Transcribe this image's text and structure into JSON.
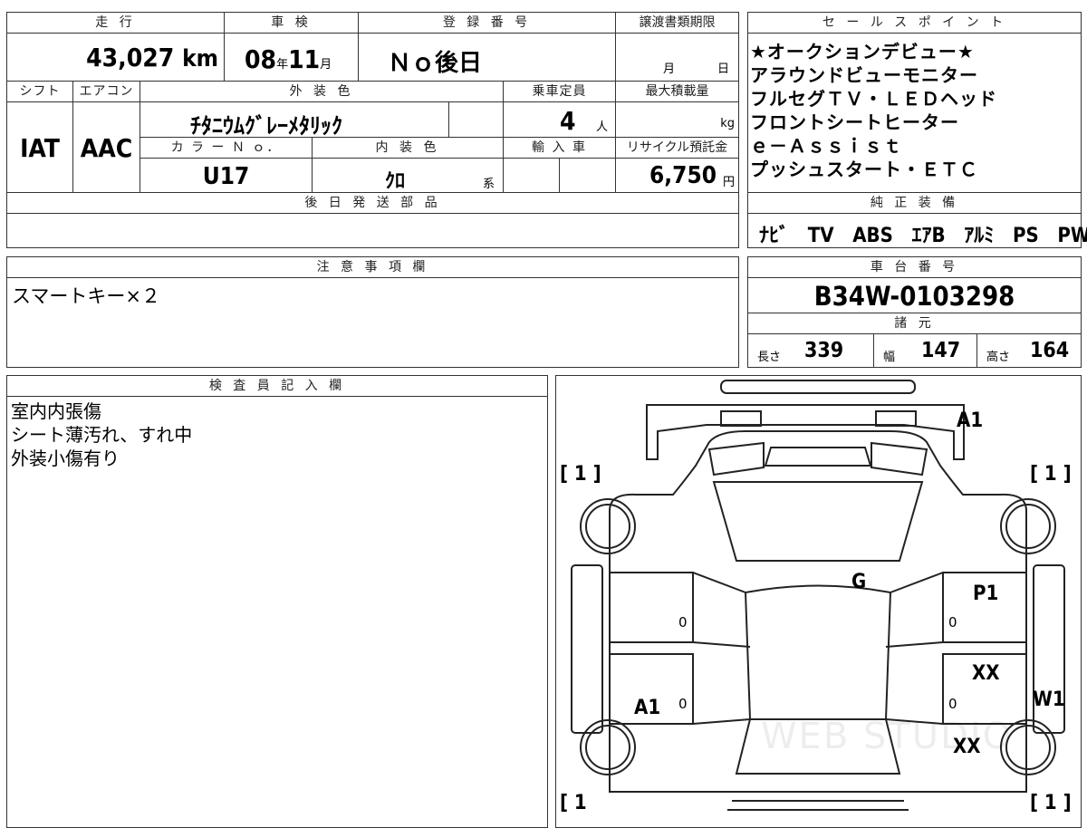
{
  "spec": {
    "mileage_label": "走 行",
    "mileage_value": "43,027",
    "mileage_unit": "km",
    "inspection_label": "車 検",
    "inspection_year": "08",
    "inspection_year_unit": "年",
    "inspection_month": "11",
    "inspection_month_unit": "月",
    "registration_label": "登 録 番 号",
    "registration_value": "Ｎｏ後日",
    "transfer_label": "譲渡書類期限",
    "transfer_month": "月",
    "transfer_day": "日",
    "shift_label": "シフト",
    "shift_value": "IAT",
    "aircon_label": "エアコン",
    "aircon_value": "AAC",
    "exterior_label": "外 装 色",
    "exterior_value": "ﾁﾀﾆｳﾑｸﾞﾚｰﾒﾀﾘｯｸ",
    "capacity_label": "乗車定員",
    "capacity_value": "4",
    "capacity_unit": "人",
    "maxload_label": "最大積載量",
    "maxload_unit": "kg",
    "colorno_label": "カ ラ ー Ｎ ｏ．",
    "colorno_value": "U17",
    "interior_label": "内 装 色",
    "interior_value": "ｸﾛ",
    "interior_suffix": "系",
    "import_label": "輸 入 車",
    "recycle_label": "リサイクル預託金",
    "recycle_value": "6,750",
    "recycle_unit": "円",
    "later_parts_label": "後 日 発 送 部 品"
  },
  "sales_points": {
    "title": "セ ー ル ス ポ イ ン ト",
    "lines": [
      "★オークションデビュー★",
      "アラウンドビューモニター",
      "フルセグＴＶ・ＬＥＤヘッド",
      "フロントシートヒーター",
      "ｅ－Ａｓｓｉｓｔ",
      "プッシュスタート・ＥＴＣ"
    ]
  },
  "equipment": {
    "title": "純 正 装 備",
    "items": [
      "ﾅﾋﾞ",
      "TV",
      "ABS",
      "ｴｱB",
      "ｱﾙﾐ",
      "PS",
      "PW"
    ]
  },
  "notes": {
    "title": "注 意 事 項 欄",
    "text": "スマートキー×２"
  },
  "chassis": {
    "title": "車 台 番 号",
    "value": "B34W-0103298"
  },
  "dimensions": {
    "title": "諸 元",
    "length_label": "長さ",
    "length_value": "339",
    "width_label": "幅",
    "width_value": "147",
    "height_label": "高さ",
    "height_value": "164"
  },
  "inspector": {
    "title": "検 査 員 記 入 欄",
    "lines": [
      "室内内張傷",
      "シート薄汚れ、すれ中",
      "外装小傷有り"
    ]
  },
  "diagram": {
    "tire_fl": "[ 1 ]",
    "tire_fr": "[ 1 ]",
    "tire_rl": "[ 1",
    "tire_rr": "[ 1 ]",
    "mark_a1_top": "A1",
    "mark_g": "G",
    "mark_p1": "P1",
    "mark_xx1": "XX",
    "mark_w1": "W1",
    "mark_xx2": "XX",
    "mark_a1_left": "A1",
    "zero": "0",
    "watermark": "WEB STUDIO"
  }
}
